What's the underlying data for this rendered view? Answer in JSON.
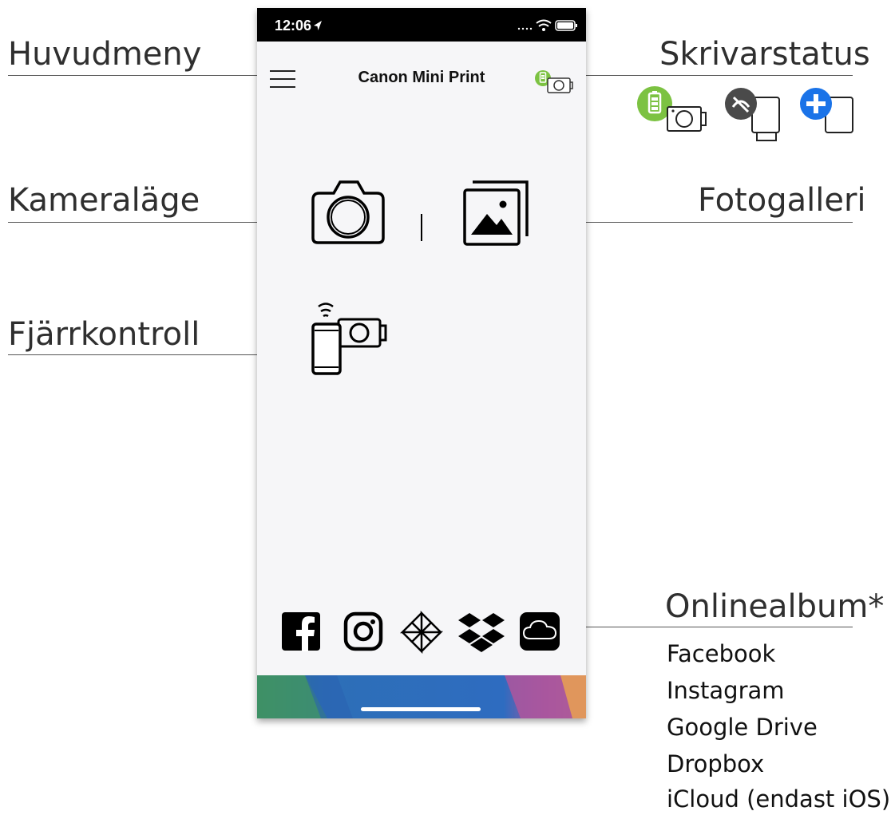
{
  "callouts": {
    "main_menu": "Huvudmeny",
    "printer_status": "Skrivarstatus",
    "camera_mode": "Kameraläge",
    "photo_gallery": "Fotogalleri",
    "remote_control": "Fjärrkontroll",
    "online_albums": "Onlinealbum*"
  },
  "online_album_list": [
    "Facebook",
    "Instagram",
    "Google Drive",
    "Dropbox",
    "iCloud (endast iOS)"
  ],
  "phone": {
    "status_time": "12:06",
    "app_title": "Canon Mini Print",
    "icons": {
      "menu": "hamburger-menu-icon",
      "printer_status": "printer-battery-icon",
      "camera_mode": "camera-icon",
      "gallery": "photo-gallery-icon",
      "remote": "remote-control-icon",
      "facebook": "facebook-icon",
      "instagram": "instagram-icon",
      "google_drive": "google-drive-icon",
      "dropbox": "dropbox-icon",
      "icloud": "icloud-icon"
    }
  },
  "colors": {
    "battery_green": "#7cc242",
    "disconnected_gray": "#4a4a4a",
    "add_blue": "#1a73e8"
  }
}
